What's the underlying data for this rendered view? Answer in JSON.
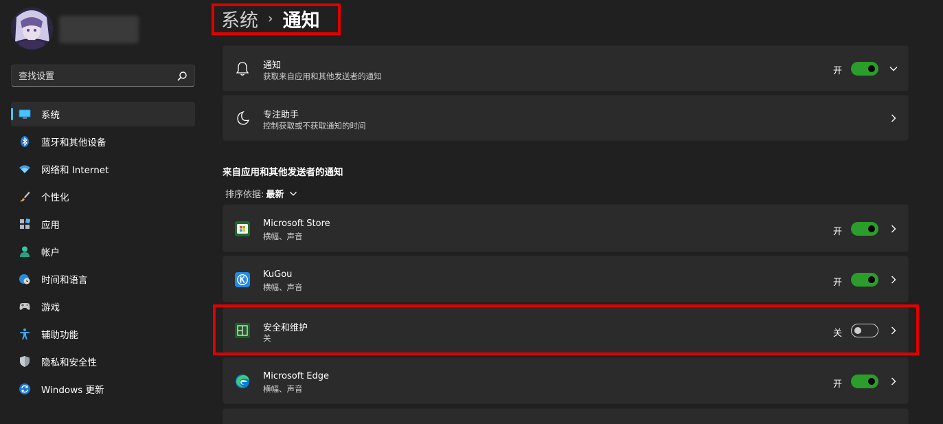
{
  "sidebar": {
    "search_placeholder": "查找设置",
    "items": [
      {
        "label": "系统",
        "icon": "display-icon",
        "active": true
      },
      {
        "label": "蓝牙和其他设备",
        "icon": "bluetooth-icon"
      },
      {
        "label": "网络和 Internet",
        "icon": "wifi-icon"
      },
      {
        "label": "个性化",
        "icon": "brush-icon"
      },
      {
        "label": "应用",
        "icon": "apps-icon"
      },
      {
        "label": "帐户",
        "icon": "person-icon"
      },
      {
        "label": "时间和语言",
        "icon": "globe-clock-icon"
      },
      {
        "label": "游戏",
        "icon": "gamepad-icon"
      },
      {
        "label": "辅助功能",
        "icon": "accessibility-icon"
      },
      {
        "label": "隐私和安全性",
        "icon": "shield-icon"
      },
      {
        "label": "Windows 更新",
        "icon": "update-icon"
      }
    ]
  },
  "breadcrumb": {
    "parent": "系统",
    "separator": "›",
    "current": "通知"
  },
  "top_cards": [
    {
      "title": "通知",
      "subtitle": "获取来自应用和其他发送者的通知",
      "state": "开",
      "toggle": "on",
      "icon": "bell-icon"
    },
    {
      "title": "专注助手",
      "subtitle": "控制获取或不获取通知的时间",
      "icon": "moon-icon"
    }
  ],
  "section": {
    "title": "来自应用和其他发送者的通知",
    "sort_label": "排序依据:",
    "sort_value": "最新"
  },
  "apps": [
    {
      "title": "Microsoft Store",
      "subtitle": "横幅、声音",
      "state": "开",
      "toggle": "on",
      "icon": "store-icon"
    },
    {
      "title": "KuGou",
      "subtitle": "横幅、声音",
      "state": "开",
      "toggle": "on",
      "icon": "kugou-icon"
    },
    {
      "title": "安全和维护",
      "subtitle": "关",
      "state": "关",
      "toggle": "off",
      "icon": "security-maintenance-icon"
    },
    {
      "title": "Microsoft Edge",
      "subtitle": "横幅、声音",
      "state": "开",
      "toggle": "on",
      "icon": "edge-icon"
    }
  ],
  "colors": {
    "background": "#202020",
    "card": "#2b2b2b",
    "toggle_on": "#2a9d2a",
    "accent": "#4cc2ff",
    "highlight": "#e00000"
  }
}
